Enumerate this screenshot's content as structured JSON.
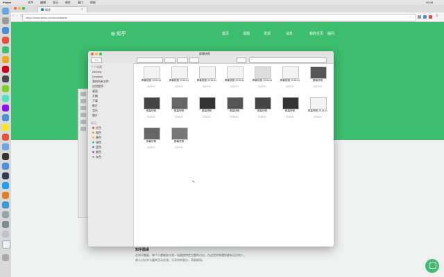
{
  "menubar": {
    "app": "Finder",
    "items": [
      "文件",
      "编辑",
      "显示",
      "前往",
      "窗口",
      "帮助"
    ],
    "clock": "09:08"
  },
  "browser": {
    "tab_title": "知乎",
    "url": "https://www.zhihu.com/roundtable"
  },
  "site": {
    "logo": "知乎",
    "nav": [
      "首页",
      "话题",
      "发现",
      "消息",
      "我的主页",
      "提问"
    ],
    "bottom_title": "知乎圆桌",
    "bottom_text_1": "在知乎圆桌，每个人都能参与到一场围绕特定主题的讨论，在这里你将遇到最有见识的人。",
    "bottom_text_2": "参与讨论并与嘉宾互动交流，分享你的观点，获取新知。"
  },
  "finder": {
    "title": "屏幕快照",
    "sidebar_sections": [
      {
        "header": "个人收藏",
        "items": [
          "AirDrop",
          "Dropbox",
          "我的所有文件",
          "应用程序",
          "桌面",
          "文稿",
          "下载",
          "影片",
          "音乐",
          "图片"
        ]
      },
      {
        "header": "标记",
        "items": [
          "红色",
          "橙色",
          "黄色",
          "绿色",
          "蓝色",
          "紫色",
          "灰色"
        ]
      }
    ],
    "tag_colors": [
      "#e74c3c",
      "#f39c12",
      "#f1c40f",
      "#2ecc71",
      "#3498db",
      "#9b59b6",
      "#95a5a6"
    ],
    "files_row1": [
      {
        "name": "屏幕快照 2015-01",
        "date": "2015-01"
      },
      {
        "name": "屏幕快照 2015-01",
        "date": "2015-01"
      },
      {
        "name": "屏幕快照 2015-01",
        "date": "2015-01"
      },
      {
        "name": "屏幕快照 2015-01",
        "date": "2015-01"
      },
      {
        "name": "屏幕快照 2015-01",
        "date": "2015-01"
      },
      {
        "name": "屏幕快照 2015-01",
        "date": "2015-01"
      },
      {
        "name": "屏幕快照",
        "date": "2015-01"
      }
    ],
    "files_row2": [
      {
        "name": "屏幕快照",
        "date": "2015-01"
      },
      {
        "name": "屏幕快照",
        "date": "2015-01"
      },
      {
        "name": "屏幕快照",
        "date": "2015-01"
      },
      {
        "name": "屏幕快照",
        "date": "2015-01"
      },
      {
        "name": "屏幕快照",
        "date": "2015-01"
      },
      {
        "name": "屏幕快照",
        "date": "2015-01"
      },
      {
        "name": "屏幕快照 2015-01",
        "date": "2015-01"
      }
    ],
    "files_row3": [
      {
        "name": "屏幕快照",
        "date": "2015-01"
      },
      {
        "name": "屏幕快照",
        "date": "2015-01"
      }
    ]
  }
}
